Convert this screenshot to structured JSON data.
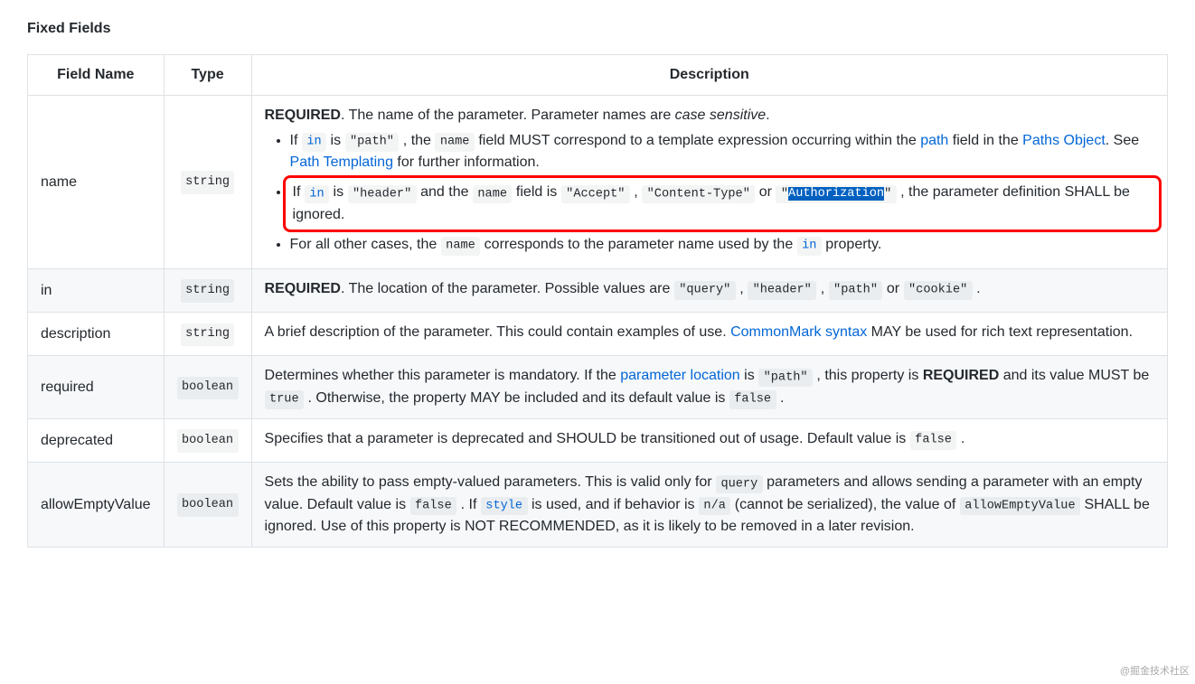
{
  "heading": "Fixed Fields",
  "columns": {
    "c0": "Field Name",
    "c1": "Type",
    "c2": "Description"
  },
  "tokens": {
    "required": "REQUIRED",
    "in": "in",
    "name": "name",
    "path_q": "\"path\"",
    "header_q": "\"header\"",
    "accept_q": "\"Accept\"",
    "ctype_q": "\"Content-Type\"",
    "auth_q_l": "\"",
    "auth_q_mid": "Authorization",
    "auth_q_r": "\"",
    "query_q": "\"query\"",
    "cookie_q": "\"cookie\"",
    "true": "true",
    "false": "false",
    "style": "style",
    "na": "n/a",
    "allowEmptyValue": "allowEmptyValue",
    "query": "query",
    "string": "string",
    "boolean": "boolean"
  },
  "rows": {
    "r0": {
      "name": "name",
      "desc": {
        "lead_a": ". The name of the parameter. Parameter names are ",
        "lead_b": "case sensitive",
        "lead_c": ".",
        "li0_a": "If ",
        "li0_b": " is ",
        "li0_c": " , the ",
        "li0_d": " field MUST correspond to a template expression occurring within the ",
        "li0_link_path": "path",
        "li0_e": " field in the ",
        "li0_link_paths_obj": "Paths Object",
        "li0_f": ". See ",
        "li0_link_tmpl": "Path Templating",
        "li0_g": " for further information.",
        "li1_a": "If ",
        "li1_b": " is ",
        "li1_c": " and the ",
        "li1_d": " field is ",
        "li1_e": " , ",
        "li1_f": " or ",
        "li1_g": " , the parameter definition SHALL be ignored.",
        "li2_a": "For all other cases, the ",
        "li2_b": " corresponds to the parameter name used by the ",
        "li2_c": " property."
      }
    },
    "r1": {
      "name": "in",
      "desc": {
        "a": ". The location of the parameter. Possible values are ",
        "b": " , ",
        "c": " , ",
        "d": " or ",
        "e": " ."
      }
    },
    "r2": {
      "name": "description",
      "desc": {
        "a": "A brief description of the parameter. This could contain examples of use. ",
        "link": "CommonMark syntax",
        "b": " MAY be used for rich text representation."
      }
    },
    "r3": {
      "name": "required",
      "desc": {
        "a": "Determines whether this parameter is mandatory. If the ",
        "link": "parameter location",
        "b": " is ",
        "c": " , this property is ",
        "d": " and its value MUST be ",
        "e": " . Otherwise, the property MAY be included and its default value is ",
        "f": " ."
      }
    },
    "r4": {
      "name": "deprecated",
      "desc": {
        "a": "Specifies that a parameter is deprecated and SHOULD be transitioned out of usage. Default value is ",
        "b": " ."
      }
    },
    "r5": {
      "name": "allowEmptyValue",
      "desc": {
        "a": "Sets the ability to pass empty-valued parameters. This is valid only for ",
        "b": " parameters and allows sending a parameter with an empty value. Default value is ",
        "c": " . If ",
        "d": " is used, and if behavior is ",
        "e": " (cannot be serialized), the value of ",
        "f": " SHALL be ignored. Use of this property is NOT RECOMMENDED, as it is likely to be removed in a later revision."
      }
    }
  },
  "watermark": "@掘金技术社区"
}
